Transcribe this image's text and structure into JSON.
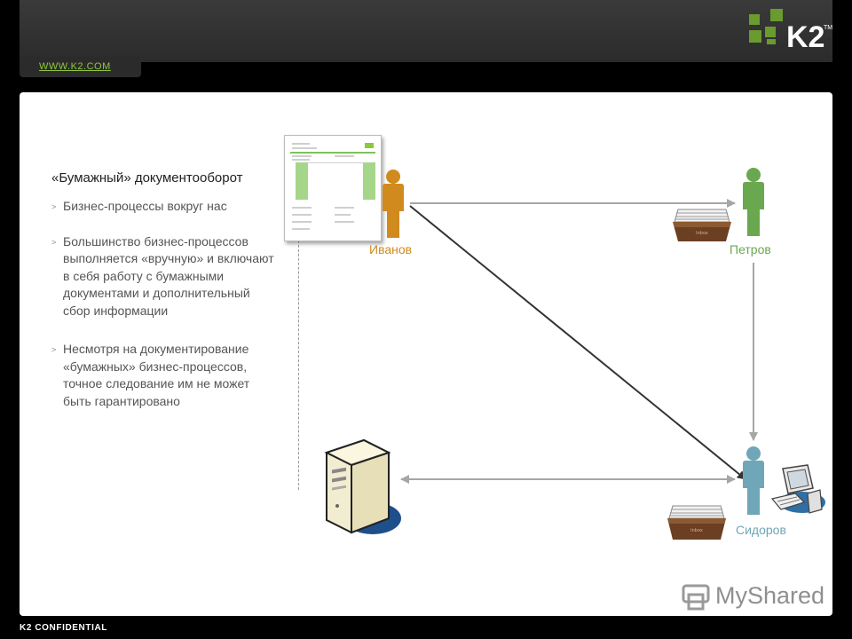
{
  "header": {
    "url": "WWW.K2.COM",
    "logo_text": "K2",
    "logo_tm": "TM"
  },
  "slide": {
    "title": "«Бумажный» документооборот",
    "bullets": [
      "Бизнес-процессы вокруг нас",
      "Большинство бизнес-процессов выполняется «вручную» и включают в себя работу с бумажными документами и дополнительный сбор информации",
      "Несмотря на документирование «бумажных» бизнес-процессов, точное следование им не может быть гарантировано"
    ]
  },
  "diagram": {
    "people": [
      {
        "name": "Иванов",
        "color": "#d08a1e"
      },
      {
        "name": "Петров",
        "color": "#6aa84f"
      },
      {
        "name": "Сидоров",
        "color": "#6fa6b8"
      }
    ],
    "inbox_label": "Inbox",
    "arrow_color": "#a6a6a6",
    "diagonal_color": "#333333"
  },
  "footer": {
    "confidential": "K2 CONFIDENTIAL",
    "watermark": "MyShared"
  },
  "colors": {
    "accent_green": "#8ec63f",
    "logo_green": "#6a9b2e"
  }
}
